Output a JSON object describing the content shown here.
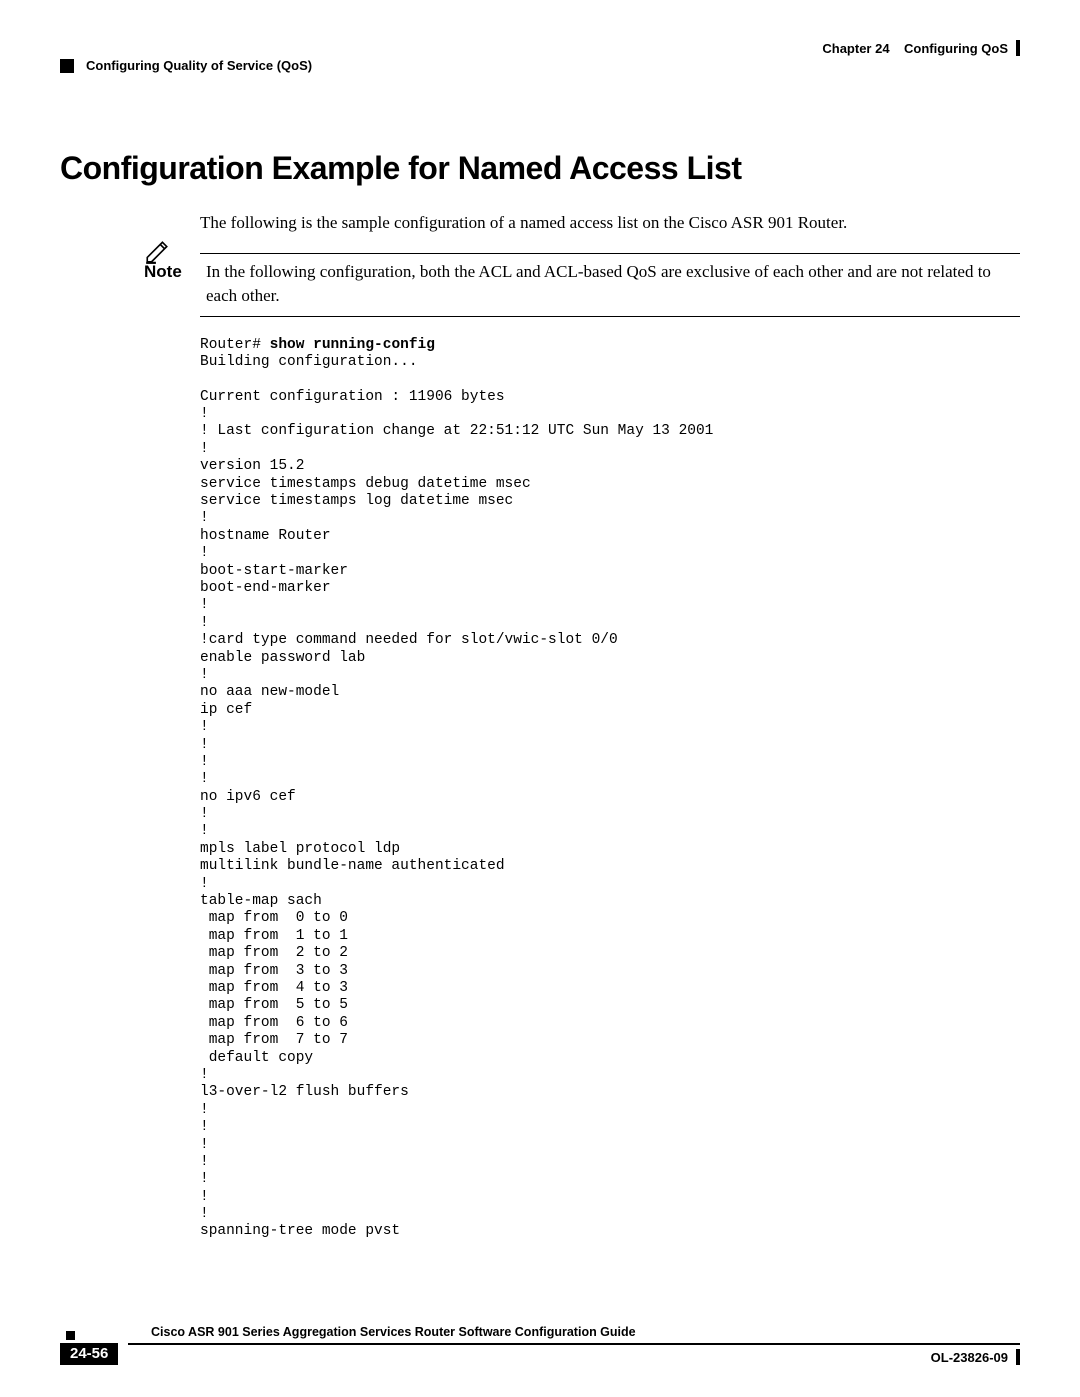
{
  "header": {
    "chapter_label": "Chapter 24",
    "chapter_title": "Configuring QoS",
    "section_title": "Configuring Quality of Service (QoS)"
  },
  "main": {
    "heading": "Configuration Example for Named Access List",
    "intro": "The following is the sample configuration of a named access list on the Cisco ASR 901 Router.",
    "note": {
      "label": "Note",
      "text": "In the following configuration, both the ACL and ACL-based QoS are exclusive of each other and are not related to each other."
    },
    "config_prompt": "Router# ",
    "config_command": "show running-config",
    "config_body": "Building configuration...\n\nCurrent configuration : 11906 bytes\n!\n! Last configuration change at 22:51:12 UTC Sun May 13 2001\n!\nversion 15.2\nservice timestamps debug datetime msec\nservice timestamps log datetime msec\n!\nhostname Router\n!\nboot-start-marker\nboot-end-marker\n!\n!\n!card type command needed for slot/vwic-slot 0/0\nenable password lab\n!\nno aaa new-model\nip cef\n!\n!\n!\n!\nno ipv6 cef\n!\n!\nmpls label protocol ldp\nmultilink bundle-name authenticated\n!\ntable-map sach\n map from  0 to 0\n map from  1 to 1\n map from  2 to 2\n map from  3 to 3\n map from  4 to 3\n map from  5 to 5\n map from  6 to 6\n map from  7 to 7\n default copy\n!\nl3-over-l2 flush buffers\n!\n!\n!\n!\n!\n!\n!\nspanning-tree mode pvst"
  },
  "footer": {
    "guide_title": "Cisco ASR 901 Series Aggregation Services Router Software Configuration Guide",
    "page_number": "24-56",
    "doc_id": "OL-23826-09"
  }
}
